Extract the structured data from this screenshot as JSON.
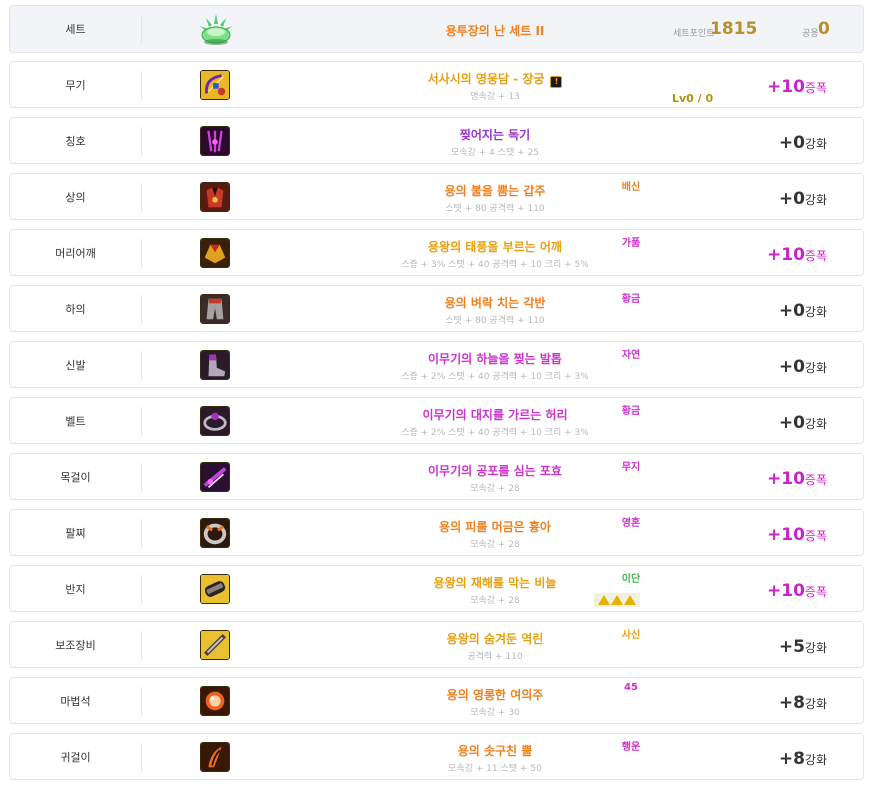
{
  "header": {
    "slot": "세트",
    "set_name": "용투장의 난 세트 II",
    "set_point_label": "세트포인트",
    "set_point_value": "1815",
    "common_label": "공용",
    "common_value": "0"
  },
  "rows": [
    {
      "slot": "무기",
      "name": "서사시의 영웅담 - 장궁",
      "stats": "명속강 + 13",
      "tag": "",
      "enh_value": "+10",
      "enh_unit": "증폭",
      "lv": "Lv0 / 0"
    },
    {
      "slot": "칭호",
      "name": "찢어지는 독기",
      "stats": "모속강 + 4 스탯 + 25",
      "tag": "",
      "enh_value": "+0",
      "enh_unit": "강화"
    },
    {
      "slot": "상의",
      "name": "용의 불을 뿜는 갑주",
      "stats": "스탯 + 80 공격력 + 110",
      "tag": "배신",
      "enh_value": "+0",
      "enh_unit": "강화"
    },
    {
      "slot": "머리어깨",
      "name": "용왕의 태풍을 부르는 어깨",
      "stats": "스증 + 3% 스탯 + 40 공격력 + 10 크리 + 5%",
      "tag": "가품",
      "enh_value": "+10",
      "enh_unit": "증폭"
    },
    {
      "slot": "하의",
      "name": "용의 벼락 치는 각반",
      "stats": "스탯 + 80 공격력 + 110",
      "tag": "황금",
      "enh_value": "+0",
      "enh_unit": "강화"
    },
    {
      "slot": "신발",
      "name": "이무기의 하늘을 찢는 발톱",
      "stats": "스증 + 2% 스탯 + 40 공격력 + 10 크리 + 3%",
      "tag": "자연",
      "enh_value": "+0",
      "enh_unit": "강화"
    },
    {
      "slot": "벨트",
      "name": "이무기의 대지를 가르는 허리",
      "stats": "스증 + 2% 스탯 + 40 공격력 + 10 크리 + 3%",
      "tag": "황금",
      "enh_value": "+0",
      "enh_unit": "강화"
    },
    {
      "slot": "목걸이",
      "name": "이무기의 공포를 심는 포효",
      "stats": "모속강 + 28",
      "tag": "무지",
      "enh_value": "+10",
      "enh_unit": "증폭"
    },
    {
      "slot": "팔찌",
      "name": "용의 피를 머금은 흉아",
      "stats": "모속강 + 28",
      "tag": "영혼",
      "enh_value": "+10",
      "enh_unit": "증폭"
    },
    {
      "slot": "반지",
      "name": "용왕의 재해를 막는 비늘",
      "stats": "모속강 + 28",
      "tag": "이단",
      "enh_value": "+10",
      "enh_unit": "증폭"
    },
    {
      "slot": "보조장비",
      "name": "용왕의 숨겨둔 역린",
      "stats": "공격력 + 110",
      "tag": "사신",
      "enh_value": "+5",
      "enh_unit": "강화"
    },
    {
      "slot": "마법석",
      "name": "용의 영롱한 여의주",
      "stats": "모속강 + 30",
      "tag": "45",
      "enh_value": "+8",
      "enh_unit": "강화"
    },
    {
      "slot": "귀걸이",
      "name": "용의 솟구친 뿔",
      "stats": "모속강 + 11 스탯 + 50",
      "tag": "행운",
      "enh_value": "+8",
      "enh_unit": "강화"
    }
  ],
  "colors": {
    "name_orange": "#f08020",
    "name_gold": "#e8a010",
    "name_purple": "#9933cc",
    "name_magenta": "#cc33cc",
    "amplify": "#cc22cc",
    "set_point": "#b89030"
  }
}
